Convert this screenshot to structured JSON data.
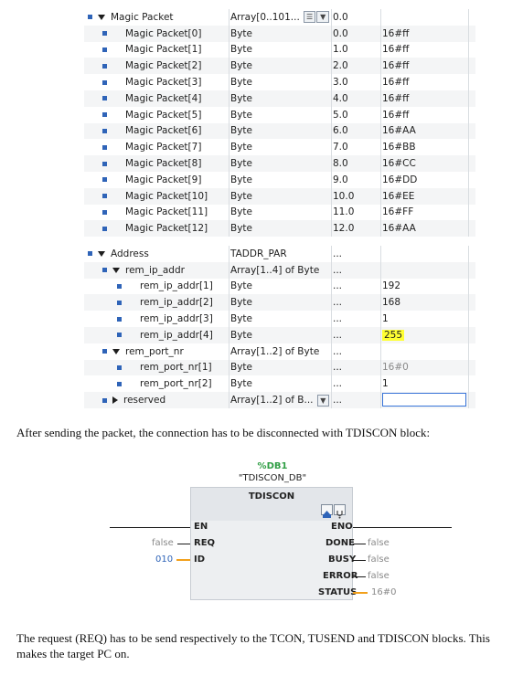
{
  "table1": {
    "rows": [
      {
        "name": "Magic Packet",
        "type": "Array[0..101...",
        "value": "0.0",
        "init": "",
        "indent": 0,
        "expand": "down",
        "group": true
      },
      {
        "name": "Magic Packet[0]",
        "type": "Byte",
        "value": "0.0",
        "init": "16#ff",
        "indent": 1
      },
      {
        "name": "Magic Packet[1]",
        "type": "Byte",
        "value": "1.0",
        "init": "16#ff",
        "indent": 1
      },
      {
        "name": "Magic Packet[2]",
        "type": "Byte",
        "value": "2.0",
        "init": "16#ff",
        "indent": 1
      },
      {
        "name": "Magic Packet[3]",
        "type": "Byte",
        "value": "3.0",
        "init": "16#ff",
        "indent": 1
      },
      {
        "name": "Magic Packet[4]",
        "type": "Byte",
        "value": "4.0",
        "init": "16#ff",
        "indent": 1
      },
      {
        "name": "Magic Packet[5]",
        "type": "Byte",
        "value": "5.0",
        "init": "16#ff",
        "indent": 1
      },
      {
        "name": "Magic Packet[6]",
        "type": "Byte",
        "value": "6.0",
        "init": "16#AA",
        "indent": 1
      },
      {
        "name": "Magic Packet[7]",
        "type": "Byte",
        "value": "7.0",
        "init": "16#BB",
        "indent": 1
      },
      {
        "name": "Magic Packet[8]",
        "type": "Byte",
        "value": "8.0",
        "init": "16#CC",
        "indent": 1
      },
      {
        "name": "Magic Packet[9]",
        "type": "Byte",
        "value": "9.0",
        "init": "16#DD",
        "indent": 1
      },
      {
        "name": "Magic Packet[10]",
        "type": "Byte",
        "value": "10.0",
        "init": "16#EE",
        "indent": 1
      },
      {
        "name": "Magic Packet[11]",
        "type": "Byte",
        "value": "11.0",
        "init": "16#FF",
        "indent": 1
      },
      {
        "name": "Magic Packet[12]",
        "type": "Byte",
        "value": "12.0",
        "init": "16#AA",
        "indent": 1
      }
    ]
  },
  "table2": {
    "rows": [
      {
        "name": "Address",
        "type": "TADDR_PAR",
        "value": "...",
        "init": "",
        "indent": 0,
        "expand": "down"
      },
      {
        "name": "rem_ip_addr",
        "type": "Array[1..4] of Byte",
        "value": "...",
        "init": "",
        "indent": 1,
        "expand": "down"
      },
      {
        "name": "rem_ip_addr[1]",
        "type": "Byte",
        "value": "...",
        "init": "192",
        "indent": 2
      },
      {
        "name": "rem_ip_addr[2]",
        "type": "Byte",
        "value": "...",
        "init": "168",
        "indent": 2
      },
      {
        "name": "rem_ip_addr[3]",
        "type": "Byte",
        "value": "...",
        "init": "1",
        "indent": 2
      },
      {
        "name": "rem_ip_addr[4]",
        "type": "Byte",
        "value": "...",
        "init": "255",
        "indent": 2,
        "highlight": true
      },
      {
        "name": "rem_port_nr",
        "type": "Array[1..2] of Byte",
        "value": "...",
        "init": "",
        "indent": 1,
        "expand": "down"
      },
      {
        "name": "rem_port_nr[1]",
        "type": "Byte",
        "value": "...",
        "init": "16#0",
        "indent": 2,
        "grey": true
      },
      {
        "name": "rem_port_nr[2]",
        "type": "Byte",
        "value": "...",
        "init": "1",
        "indent": 2
      },
      {
        "name": "reserved",
        "type": "Array[1..2] of B...",
        "value": "...",
        "init": "",
        "indent": 1,
        "expand": "right",
        "selected": true
      }
    ]
  },
  "text": {
    "para1": "After sending the packet, the connection has to be disconnected with TDISCON block:",
    "para2_line1": "The request (REQ) has to be send respectively to the TCON, TUSEND and TDISCON blocks. This",
    "para2_line2": "makes the target PC on."
  },
  "block": {
    "db_addr": "%DB1",
    "db_name": "\"TDISCON_DB\"",
    "title": "TDISCON",
    "in_pins": [
      "EN",
      "REQ",
      "ID"
    ],
    "in_values": [
      "",
      "false",
      "010"
    ],
    "out_pins": [
      "ENO",
      "DONE",
      "BUSY",
      "ERROR",
      "STATUS"
    ],
    "out_values": [
      "",
      "false",
      "false",
      "false",
      "16#0"
    ]
  },
  "colors": {
    "db_addr": "#2f9e44",
    "id_value": "#2f64b8",
    "wire_orange": "#f2a01b",
    "highlight": "#ffff33"
  }
}
